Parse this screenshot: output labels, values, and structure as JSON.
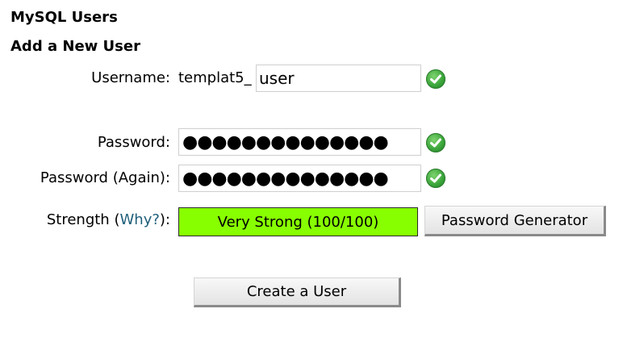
{
  "headings": {
    "section": "MySQL Users",
    "subsection": "Add a New User"
  },
  "form": {
    "username_label": "Username:",
    "username_prefix": "templat5_",
    "username_value": "user",
    "password_label": "Password:",
    "password_value": "●●●●●●●●●●●●●●",
    "password_again_label": "Password (Again):",
    "password_again_value": "●●●●●●●●●●●●●●",
    "strength_label": "Strength",
    "strength_open": "(",
    "strength_link": "Why?",
    "strength_close": "):",
    "strength_value": "Very Strong (100/100)",
    "password_generator_label": "Password Generator",
    "create_label": "Create a User"
  },
  "colors": {
    "strength_fill": "#88ff00",
    "link": "#1f5f7a",
    "check": "#3aa53a"
  },
  "icons": {
    "valid": "check-circle-icon"
  }
}
